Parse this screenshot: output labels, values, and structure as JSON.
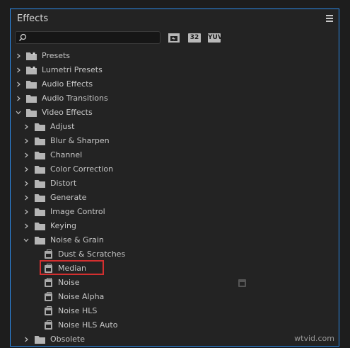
{
  "panel": {
    "title": "Effects"
  },
  "search": {
    "value": "",
    "placeholder": ""
  },
  "filters": [
    "32",
    "YUV"
  ],
  "tree": [
    {
      "label": "Presets",
      "level": 0,
      "expanded": false,
      "icon": "star-folder-icon"
    },
    {
      "label": "Lumetri Presets",
      "level": 0,
      "expanded": false,
      "icon": "star-folder-icon"
    },
    {
      "label": "Audio Effects",
      "level": 0,
      "expanded": false,
      "icon": "folder-icon"
    },
    {
      "label": "Audio Transitions",
      "level": 0,
      "expanded": false,
      "icon": "folder-icon"
    },
    {
      "label": "Video Effects",
      "level": 0,
      "expanded": true,
      "icon": "folder-icon"
    },
    {
      "label": "Adjust",
      "level": 1,
      "expanded": false,
      "icon": "folder-icon"
    },
    {
      "label": "Blur & Sharpen",
      "level": 1,
      "expanded": false,
      "icon": "folder-icon"
    },
    {
      "label": "Channel",
      "level": 1,
      "expanded": false,
      "icon": "folder-icon"
    },
    {
      "label": "Color Correction",
      "level": 1,
      "expanded": false,
      "icon": "folder-icon"
    },
    {
      "label": "Distort",
      "level": 1,
      "expanded": false,
      "icon": "folder-icon"
    },
    {
      "label": "Generate",
      "level": 1,
      "expanded": false,
      "icon": "folder-icon"
    },
    {
      "label": "Image Control",
      "level": 1,
      "expanded": false,
      "icon": "folder-icon"
    },
    {
      "label": "Keying",
      "level": 1,
      "expanded": false,
      "icon": "folder-icon"
    },
    {
      "label": "Noise & Grain",
      "level": 1,
      "expanded": true,
      "icon": "folder-icon"
    },
    {
      "label": "Dust & Scratches",
      "level": 2,
      "icon": "effect-icon"
    },
    {
      "label": "Median",
      "level": 2,
      "icon": "effect-icon",
      "highlighted": true
    },
    {
      "label": "Noise",
      "level": 2,
      "icon": "effect-icon",
      "accelerated": true
    },
    {
      "label": "Noise Alpha",
      "level": 2,
      "icon": "effect-icon"
    },
    {
      "label": "Noise HLS",
      "level": 2,
      "icon": "effect-icon"
    },
    {
      "label": "Noise HLS Auto",
      "level": 2,
      "icon": "effect-icon"
    },
    {
      "label": "Obsolete",
      "level": 1,
      "expanded": false,
      "icon": "folder-icon"
    }
  ],
  "watermark": "wtvid.com",
  "colors": {
    "accent": "#2d8ceb",
    "highlight": "#d32f2f"
  }
}
